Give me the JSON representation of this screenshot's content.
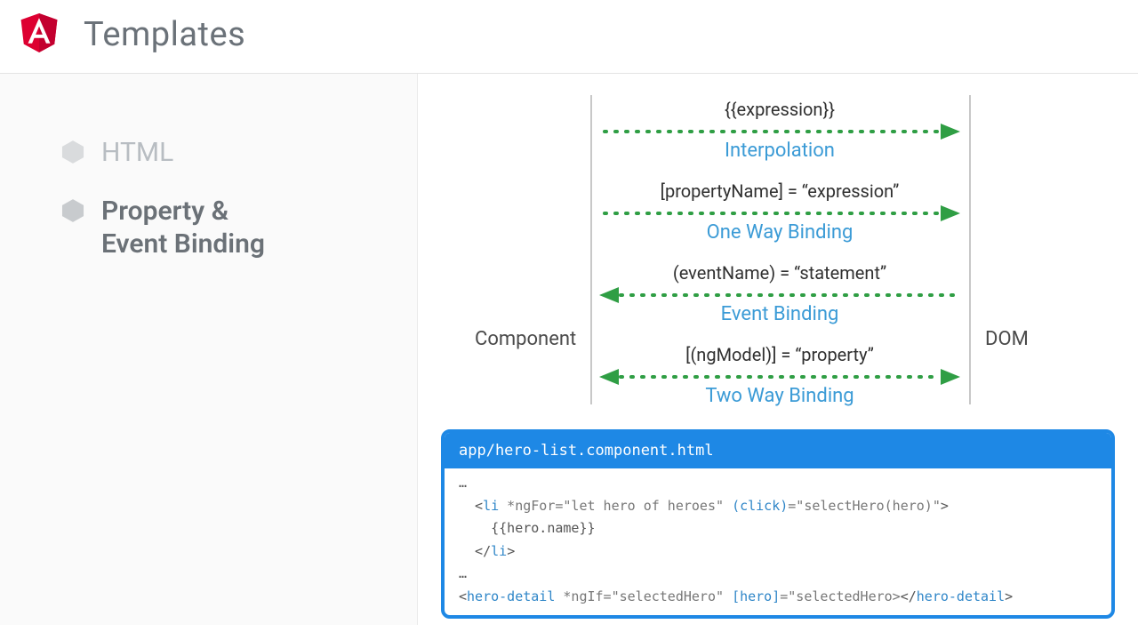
{
  "header": {
    "title": "Templates"
  },
  "sidebar": {
    "items": [
      {
        "label": "HTML"
      },
      {
        "label": "Property &\nEvent Binding"
      }
    ]
  },
  "diagram": {
    "leftLabel": "Component",
    "rightLabel": "DOM",
    "rows": [
      {
        "syntax": "{{expression}}",
        "name": "Interpolation",
        "direction": "right"
      },
      {
        "syntax": "[propertyName] = “expression”",
        "name": "One Way Binding",
        "direction": "right"
      },
      {
        "syntax": "(eventName) = “statement”",
        "name": "Event Binding",
        "direction": "left"
      },
      {
        "syntax": "[(ngModel)] = “property”",
        "name": "Two Way Binding",
        "direction": "both"
      }
    ]
  },
  "code": {
    "file": "app/hero-list.component.html",
    "line0": "…",
    "line1_open_tag": "li",
    "line1_attrs_a": " *ngFor=\"let hero of heroes\" ",
    "line1_attrs_b": "(click)",
    "line1_attrs_c": "=\"selectHero(hero)\"",
    "line2": "{{hero.name}}",
    "line3_close_tag": "li",
    "line4": "…",
    "line5_tag": "hero-detail",
    "line5_attrs_a": " *ngIf=\"selectedHero\" ",
    "line5_attrs_b": "[hero]",
    "line5_attrs_c": "=\"selectedHero>"
  }
}
